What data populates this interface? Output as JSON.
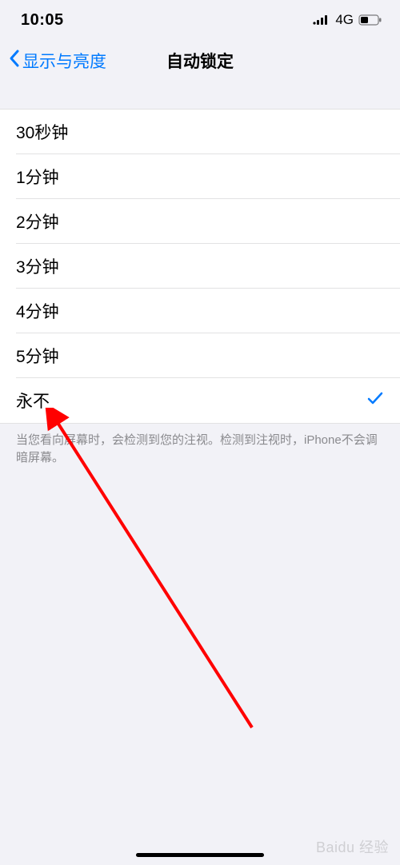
{
  "status": {
    "time": "10:05",
    "network": "4G"
  },
  "nav": {
    "back_label": "显示与亮度",
    "title": "自动锁定"
  },
  "options": [
    {
      "label": "30秒钟",
      "selected": false
    },
    {
      "label": "1分钟",
      "selected": false
    },
    {
      "label": "2分钟",
      "selected": false
    },
    {
      "label": "3分钟",
      "selected": false
    },
    {
      "label": "4分钟",
      "selected": false
    },
    {
      "label": "5分钟",
      "selected": false
    },
    {
      "label": "永不",
      "selected": true
    }
  ],
  "footer_note": "当您看向屏幕时，会检测到您的注视。检测到注视时，iPhone不会调暗屏幕。",
  "watermark": "Baidu 经验",
  "colors": {
    "accent": "#007aff",
    "annotation": "#ff0000"
  }
}
